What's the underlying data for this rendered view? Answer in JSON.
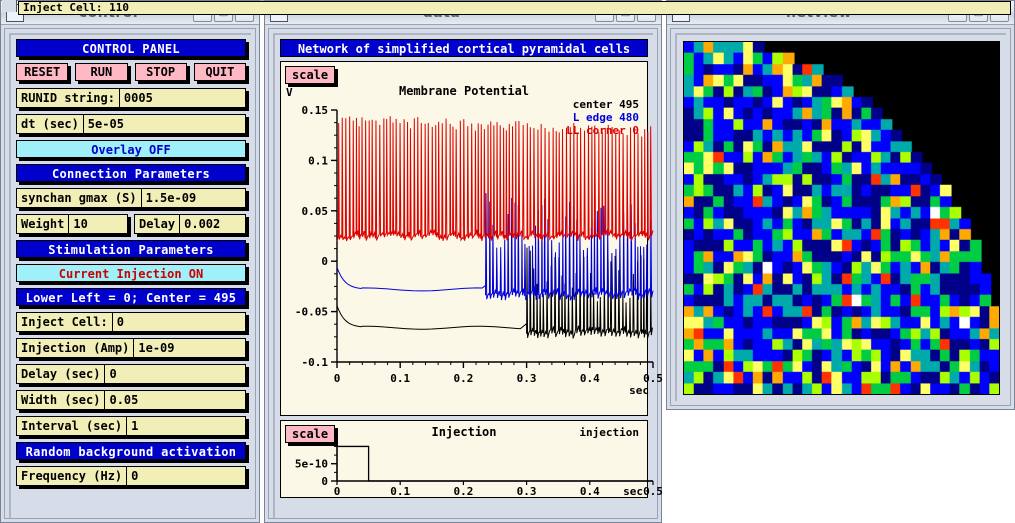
{
  "windows": {
    "control": {
      "title": "control",
      "min": "–",
      "max": "□",
      "close": "✕"
    },
    "data": {
      "title": "data",
      "min": "–",
      "max": "□",
      "close": "✕"
    },
    "netview": {
      "title": "netview",
      "min": "–",
      "max": "□",
      "close": "✕"
    }
  },
  "control_panel": {
    "header": "CONTROL PANEL",
    "buttons": [
      {
        "label": "RESET"
      },
      {
        "label": "RUN"
      },
      {
        "label": "STOP"
      },
      {
        "label": "QUIT"
      }
    ],
    "runid": {
      "label": "RUNID string:",
      "value": "0005"
    },
    "dt": {
      "label": "dt (sec)",
      "value": "5e-05"
    },
    "overlay": {
      "label": "Overlay OFF"
    },
    "connection_header": "Connection Parameters",
    "synchan": {
      "label": "synchan gmax (S)",
      "value": "1.5e-09"
    },
    "weight": {
      "label": "Weight",
      "value": "10"
    },
    "delay_conn": {
      "label": "Delay",
      "value": "0.002"
    },
    "stim_header": "Stimulation Parameters",
    "current_injection": {
      "label": "Current Injection ON"
    },
    "cell_info": "Lower Left = 0; Center = 495",
    "inject_cell": {
      "label": "Inject Cell:",
      "value": "0"
    },
    "injection_amp": {
      "label": "Injection (Amp)",
      "value": "1e-09"
    },
    "delay_sec": {
      "label": "Delay (sec)",
      "value": "0"
    },
    "width_sec": {
      "label": "Width (sec)",
      "value": "0.05"
    },
    "interval_sec": {
      "label": "Interval (sec)",
      "value": "1"
    },
    "random_header": "Random background activation",
    "frequency": {
      "label": "Frequency (Hz)",
      "value": "0"
    }
  },
  "data_window": {
    "banner": "Network of simplified cortical pyramidal cells",
    "scale_button": "scale",
    "main_plot": {
      "title": "Membrane Potential",
      "yaxis_unit": "V",
      "xaxis_unit": "sec",
      "legend": [
        {
          "label": "center 495",
          "color": "#000000"
        },
        {
          "label": "L edge 480",
          "color": "#0000dd"
        },
        {
          "label": "LL corner 0",
          "color": "#dd0000"
        }
      ]
    },
    "injection_plot": {
      "title": "Injection",
      "trace_label": "injection",
      "scale_button": "scale",
      "xaxis_unit": "sec"
    }
  },
  "bottom_window": {
    "text": "Inject Cell: 110"
  },
  "colors": {
    "banner_blue": "#0000cc",
    "button_pink": "#ffb9c4",
    "field_yellow": "#f2eeb8",
    "cyan_bar": "#9ff0f8",
    "plot_bg": "#fbf8e8",
    "trace_center": "#000000",
    "trace_ledge": "#0000dd",
    "trace_llcorner": "#dd0000"
  },
  "chart_data": [
    {
      "type": "line",
      "title": "Membrane Potential",
      "xlabel": "sec",
      "ylabel": "V",
      "xlim": [
        0,
        0.5
      ],
      "ylim": [
        -0.1,
        0.15
      ],
      "xticks": [
        0,
        0.1,
        0.2,
        0.3,
        0.4,
        0.5
      ],
      "xtick_labels": [
        "0",
        "0.1",
        "0.2",
        "0.3",
        "0.4",
        "0.5"
      ],
      "yticks": [
        -0.1,
        -0.05,
        0,
        0.05,
        0.1,
        0.15
      ],
      "ytick_labels": [
        "-0.1",
        "-0.05",
        "0",
        "0.05",
        "0.1",
        "0.15"
      ],
      "grid": false,
      "legend_position": "top-right",
      "series": [
        {
          "name": "LL corner 0",
          "color": "#dd0000",
          "description": "Spiking from t=0; spike peaks ~0.14 V decaying toward ~0.12 V, troughs ~0.02 to 0.03 V, firing continuously across whole trace",
          "spike_onset": 0.0,
          "spike_peak": 0.14,
          "spike_trough": 0.025,
          "baseline": -0.002
        },
        {
          "name": "L edge 480",
          "color": "#0000dd",
          "description": "Flat baseline near -0.028 V until t=0.235 then bursts of spikes with peaks ~0.065 V and troughs ~-0.03 V",
          "spike_onset": 0.235,
          "spike_peak": 0.065,
          "spike_trough": -0.032,
          "baseline": -0.028
        },
        {
          "name": "center 495",
          "color": "#000000",
          "description": "Flat baseline near -0.066 V until t=0.30 then bursting with peaks ~0.012 V and troughs ~-0.07 V",
          "spike_onset": 0.3,
          "spike_peak": 0.012,
          "spike_trough": -0.07,
          "baseline": -0.066
        }
      ]
    },
    {
      "type": "line",
      "title": "Injection",
      "xlabel": "sec",
      "ylabel": "",
      "xlim": [
        0,
        0.5
      ],
      "ylim": [
        0,
        1.1e-09
      ],
      "xticks": [
        0,
        0.1,
        0.2,
        0.3,
        0.4,
        0.5
      ],
      "xtick_labels": [
        "0",
        "0.1",
        "0.2",
        "0.3",
        "0.4",
        "0.5"
      ],
      "yticks": [
        0,
        5e-10
      ],
      "ytick_labels": [
        "0",
        "5e-10"
      ],
      "grid": false,
      "series": [
        {
          "name": "injection",
          "color": "#000000",
          "description": "Rectangular pulse of amplitude 1e-09 A from t=0 to t=0.05 s, then 0",
          "x": [
            0,
            0,
            0.05,
            0.05,
            0.5
          ],
          "y": [
            0,
            1e-09,
            1e-09,
            0,
            0
          ]
        }
      ]
    },
    {
      "type": "heatmap",
      "title": "netview",
      "description": "32x32 grid of cell activity; mostly blue with scattered green/yellow/orange/red/white cells; upper-right quadrant masked black by a quarter-circle boundary",
      "rows": 32,
      "cols": 32,
      "colormap": [
        "#000088",
        "#0000ff",
        "#00aaaa",
        "#00cc44",
        "#aaff00",
        "#ffff66",
        "#ffaa00",
        "#ff3300",
        "#ffffff"
      ],
      "background": "#000000"
    }
  ]
}
